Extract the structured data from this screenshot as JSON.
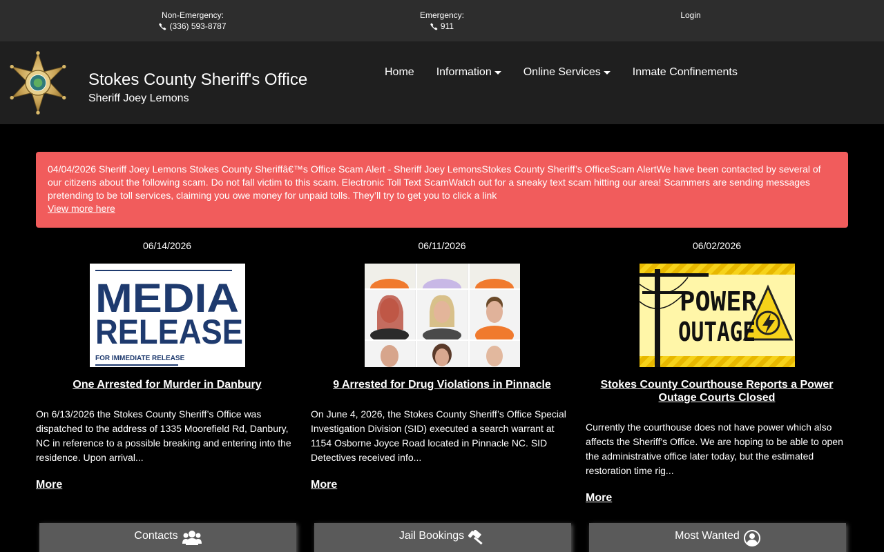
{
  "topbar": {
    "non_emergency_label": "Non-Emergency:",
    "non_emergency_number": "(336) 593-8787",
    "emergency_label": "Emergency:",
    "emergency_number": "911",
    "login": "Login"
  },
  "header": {
    "title": "Stokes County Sheriff's Office",
    "subtitle": "Sheriff Joey Lemons",
    "logo_icon": "sheriff-star-badge-icon"
  },
  "nav": {
    "home": "Home",
    "information": "Information",
    "online_services": "Online Services",
    "inmate_confinements": "Inmate Confinements"
  },
  "alert": {
    "text": "04/04/2026 Sheriff Joey Lemons Stokes County Sheriffâ€™s Office Scam Alert - Sheriff Joey LemonsStokes County Sheriff’s OfficeScam AlertWe have been contacted by several of our citizens about the following scam. Do not fall victim to this scam. Electronic Toll Text ScamWatch out for a sneaky text scam hitting our area! Scammers are sending messages pretending to be toll services, claiming you owe money for unpaid tolls. They’ll try to get you to click a link",
    "link": "View more here",
    "color": "#f15c5c"
  },
  "news": [
    {
      "date": "06/14/2026",
      "thumb_line1": "MEDIA",
      "thumb_line2": "RELEASE",
      "thumb_line3": "FOR IMMEDIATE RELEASE",
      "title": "One Arrested for Murder in Danbury",
      "body": "On 6/13/2026 the Stokes County Sheriff’s Office was dispatched to the address of 1335 Moorefield Rd, Danbury, NC in reference to a possible breaking and entering into the residence. Upon arrival...",
      "more": "More"
    },
    {
      "date": "06/11/2026",
      "title": "9 Arrested for Drug Violations in Pinnacle",
      "body": "On June 4, 2026, the Stokes County Sheriff’s Office Special Investigation Division (SID) executed a search warrant at 1154 Osborne Joyce Road located in Pinnacle NC. SID Detectives received info...",
      "more": "More"
    },
    {
      "date": "06/02/2026",
      "thumb_line1": "POWER",
      "thumb_line2": "OUTAGE",
      "title": "Stokes County Courthouse Reports a Power Outage Courts Closed",
      "body": "Currently the courthouse does not have power which also affects the Sheriff's Office. We are hoping to be able to open the administrative office later today, but the estimated restoration time rig...",
      "more": "More"
    }
  ],
  "buttons": {
    "contacts": "Contacts",
    "jail_bookings": "Jail Bookings",
    "most_wanted": "Most Wanted"
  }
}
